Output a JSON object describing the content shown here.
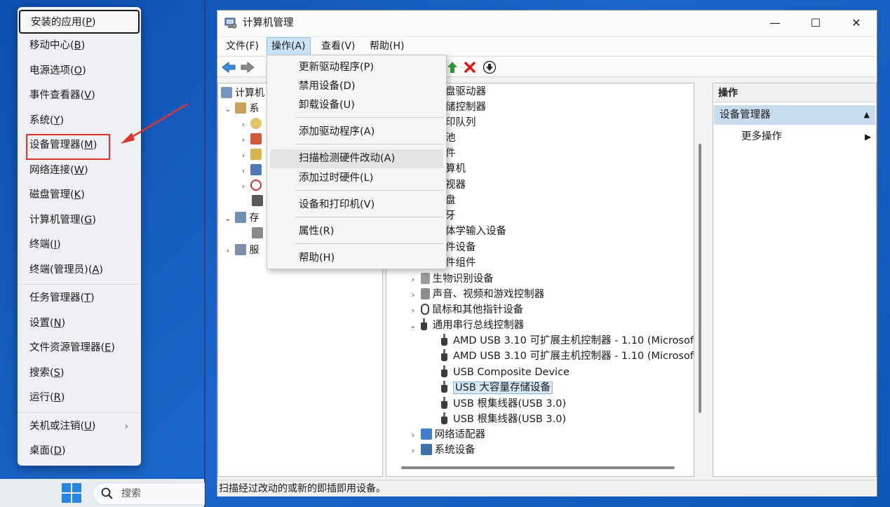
{
  "winx_menu": {
    "items": [
      {
        "text": "安装的应用(",
        "key": "P",
        "tail": ")"
      },
      {
        "text": "移动中心(",
        "key": "B",
        "tail": ")"
      },
      {
        "text": "电源选项(",
        "key": "O",
        "tail": ")"
      },
      {
        "text": "事件查看器(",
        "key": "V",
        "tail": ")"
      },
      {
        "text": "系统(",
        "key": "Y",
        "tail": ")"
      },
      {
        "text": "设备管理器(",
        "key": "M",
        "tail": ")"
      },
      {
        "text": "网络连接(",
        "key": "W",
        "tail": ")"
      },
      {
        "text": "磁盘管理(",
        "key": "K",
        "tail": ")"
      },
      {
        "text": "计算机管理(",
        "key": "G",
        "tail": ")"
      },
      {
        "text": "终端(",
        "key": "I",
        "tail": ")"
      },
      {
        "text": "终端(管理员)(",
        "key": "A",
        "tail": ")"
      },
      {
        "text": "任务管理器(",
        "key": "T",
        "tail": ")"
      },
      {
        "text": "设置(",
        "key": "N",
        "tail": ")"
      },
      {
        "text": "文件资源管理器(",
        "key": "E",
        "tail": ")"
      },
      {
        "text": "搜索(",
        "key": "S",
        "tail": ")"
      },
      {
        "text": "运行(",
        "key": "R",
        "tail": ")"
      },
      {
        "text": "关机或注销(",
        "key": "U",
        "tail": ")"
      },
      {
        "text": "桌面(",
        "key": "D",
        "tail": ")"
      }
    ],
    "chevron": "›"
  },
  "taskbar": {
    "search_placeholder": "搜索"
  },
  "window": {
    "title": "计算机管理",
    "controls": {
      "minimize": "—",
      "maximize": "☐",
      "close": "✕"
    },
    "menu": [
      "文件(F)",
      "操作(A)",
      "查看(V)",
      "帮助(H)"
    ],
    "status": "扫描经过改动的或新的即插即用设备。"
  },
  "left_tree": [
    {
      "label": "计算机",
      "twisty": ""
    },
    {
      "label": "系",
      "twisty": "⌄"
    },
    {
      "label": "",
      "twisty": "›"
    },
    {
      "label": "",
      "twisty": "›"
    },
    {
      "label": "",
      "twisty": "›"
    },
    {
      "label": "",
      "twisty": "›"
    },
    {
      "label": "",
      "twisty": "›"
    },
    {
      "label": "",
      "twisty": ""
    },
    {
      "label": "存",
      "twisty": "⌄"
    },
    {
      "label": "",
      "twisty": ""
    },
    {
      "label": "服",
      "twisty": "›"
    }
  ],
  "device_tree": {
    "partial_categories": [
      "盘驱动器",
      "储控制器",
      "印队列",
      "池",
      "件",
      "算机",
      "视器",
      "盘",
      "牙",
      "体学输入设备",
      "件设备",
      "件组件"
    ],
    "categories": [
      {
        "label": "生物识别设备",
        "twisty": "›"
      },
      {
        "label": "声音、视频和游戏控制器",
        "twisty": "›"
      },
      {
        "label": "鼠标和其他指针设备",
        "twisty": "›"
      },
      {
        "label": "通用串行总线控制器",
        "twisty": "⌄"
      }
    ],
    "usb_children": [
      "AMD USB 3.10 可扩展主机控制器 - 1.10 (Microsoft",
      "AMD USB 3.10 可扩展主机控制器 - 1.10 (Microsoft",
      "USB Composite Device",
      "USB 大容量存储设备",
      "USB 根集线器(USB 3.0)",
      "USB 根集线器(USB 3.0)"
    ],
    "selected_child": "USB 大容量存储设备",
    "after": [
      {
        "label": "网络适配器",
        "twisty": "›"
      },
      {
        "label": "系统设备",
        "twisty": "›"
      }
    ]
  },
  "actions_pane": {
    "header": "操作",
    "section": "设备管理器",
    "section_arrow": "▲",
    "item": "更多操作",
    "item_arrow": "▶"
  },
  "dropdown": {
    "items": [
      "更新驱动程序(P)",
      "禁用设备(D)",
      "卸载设备(U)",
      "添加驱动程序(A)",
      "扫描检测硬件改动(A)",
      "添加过时硬件(L)",
      "设备和打印机(V)",
      "属性(R)",
      "帮助(H)"
    ],
    "hovered": "扫描检测硬件改动(A)"
  },
  "colors": {
    "desktop": "#1552a8",
    "highlight_box": "#e0342a",
    "selection": "#d7e9f7",
    "actions_section": "#c8dcef"
  }
}
